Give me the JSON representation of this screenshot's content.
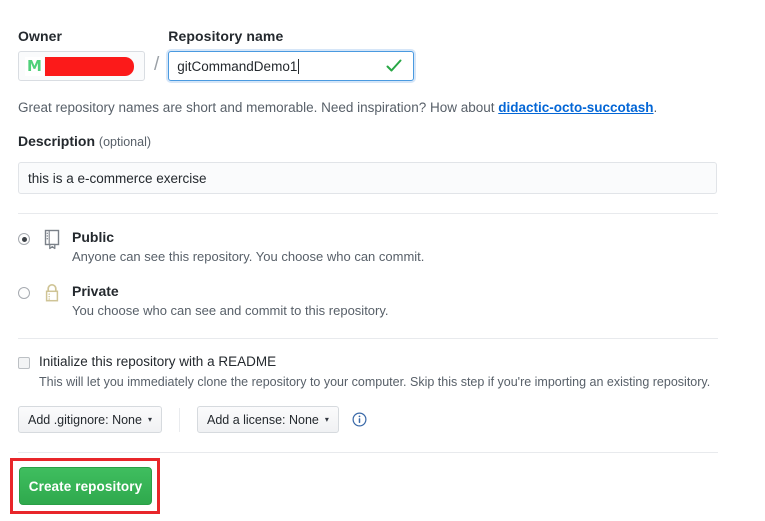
{
  "form": {
    "owner": {
      "label": "Owner",
      "avatar_initial": "M",
      "name_redacted": true
    },
    "separator": "/",
    "repo_name": {
      "label": "Repository name",
      "value": "gitCommandDemo1",
      "valid": true,
      "focused": true
    },
    "helper": {
      "text_before": "Great repository names are short and memorable. Need inspiration? How about ",
      "suggestion": "didactic-octo-succotash",
      "text_after": "."
    },
    "description": {
      "label": "Description",
      "optional_label": "(optional)",
      "value": "this is a e-commerce exercise"
    },
    "visibility": {
      "selected": "public",
      "options": [
        {
          "id": "public",
          "title": "Public",
          "description": "Anyone can see this repository. You choose who can commit.",
          "icon": "repo-icon",
          "checked": true
        },
        {
          "id": "private",
          "title": "Private",
          "description": "You choose who can see and commit to this repository.",
          "icon": "lock-icon",
          "checked": false
        }
      ]
    },
    "readme": {
      "title": "Initialize this repository with a README",
      "description": "This will let you immediately clone the repository to your computer. Skip this step if you're importing an existing repository.",
      "checked": false
    },
    "gitignore_button": {
      "label": "Add .gitignore: None",
      "caret": "▾"
    },
    "license_button": {
      "label": "Add a license: None",
      "caret": "▾"
    },
    "info_icon_name": "info-icon",
    "submit": {
      "label": "Create repository"
    }
  },
  "colors": {
    "accent_blue": "#0366d6",
    "focus_border": "#4a9ae0",
    "success_green": "#28a745",
    "button_green": "#2fa94d",
    "annotation_red": "#e8262a",
    "redaction_red": "#fc1a1a",
    "lock_tan": "#d5c99a",
    "muted_text": "#586069"
  }
}
